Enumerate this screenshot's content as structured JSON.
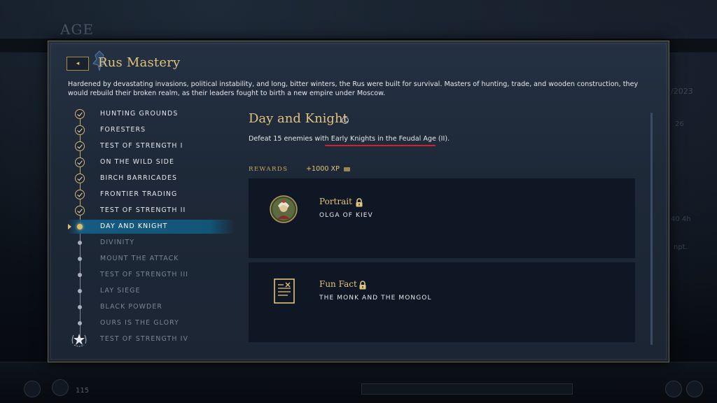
{
  "background": {
    "age_label": "AGE",
    "date_fragment": "/2023",
    "side_fragments": [
      "26",
      "40 4h",
      "npt."
    ],
    "level": "115"
  },
  "modal": {
    "back_glyph": "◂",
    "title": "Rus Mastery",
    "description": "Hardened by devastating invasions, political instability, and long, bitter winters, the Rus were built for survival. Masters of hunting, trade, and wooden construction, they would rebuild their broken realm, as their leaders fought to birth a new empire under Moscow."
  },
  "challenges": [
    {
      "label": "HUNTING GROUNDS",
      "state": "done"
    },
    {
      "label": "FORESTERS",
      "state": "done"
    },
    {
      "label": "TEST OF STRENGTH I",
      "state": "done"
    },
    {
      "label": "ON THE WILD SIDE",
      "state": "done"
    },
    {
      "label": "BIRCH BARRICADES",
      "state": "done"
    },
    {
      "label": "FRONTIER TRADING",
      "state": "done"
    },
    {
      "label": "TEST OF STRENGTH II",
      "state": "done"
    },
    {
      "label": "DAY AND KNIGHT",
      "state": "current"
    },
    {
      "label": "DIVINITY",
      "state": "locked"
    },
    {
      "label": "MOUNT THE ATTACK",
      "state": "locked"
    },
    {
      "label": "TEST OF STRENGTH III",
      "state": "locked"
    },
    {
      "label": "LAY SIEGE",
      "state": "locked"
    },
    {
      "label": "BLACK POWDER",
      "state": "locked"
    },
    {
      "label": "OURS IS THE GLORY",
      "state": "locked"
    },
    {
      "label": "TEST OF STRENGTH IV",
      "state": "final"
    }
  ],
  "detail": {
    "title": "Day and Knight",
    "info_glyph": "i",
    "objective_prefix": "Defeat 15 enemies with ",
    "objective_highlight": "Early Knights in the Feudal Age (II)",
    "objective_suffix": ".",
    "rewards_label": "REWARDS",
    "xp": "+1000 XP"
  },
  "rewards": [
    {
      "title": "Portrait",
      "subtitle": "OLGA OF KIEV",
      "icon": "portrait-icon",
      "locked": true
    },
    {
      "title": "Fun Fact",
      "subtitle": "THE MONK AND THE MONGOL",
      "icon": "scroll-document-icon",
      "locked": true
    }
  ],
  "colors": {
    "gold": "#e2c37e",
    "highlight_blue": "#155a82",
    "annotation_red": "#d2202e",
    "card_bg": "#0f1624"
  }
}
